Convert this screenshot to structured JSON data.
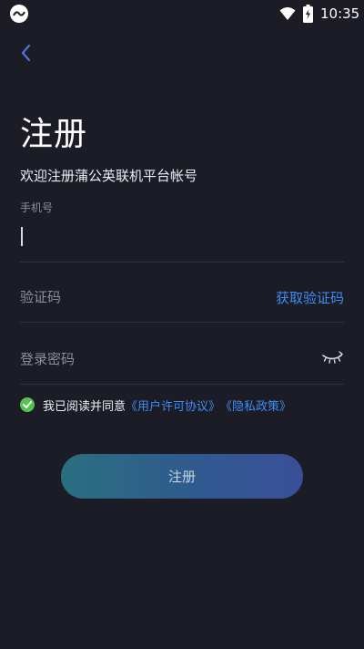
{
  "status_bar": {
    "time": "10:35",
    "app_icon": "app-badge-icon",
    "wifi_icon": "wifi-icon",
    "battery_icon": "battery-charging-icon"
  },
  "header": {
    "back_icon": "chevron-left-icon"
  },
  "title": "注册",
  "subtitle": "欢迎注册蒲公英联机平台帐号",
  "phone": {
    "label": "手机号",
    "value": ""
  },
  "code": {
    "placeholder": "验证码",
    "get_code_label": "获取验证码"
  },
  "password": {
    "placeholder": "登录密码",
    "toggle_icon": "eye-closed-icon"
  },
  "agreement": {
    "checked": true,
    "text": "我已阅读并同意",
    "user_license": "《用户许可协议》",
    "privacy_policy": "《隐私政策》"
  },
  "register_button_label": "注册",
  "colors": {
    "background": "#1b1c26",
    "accent": "#3d8df5",
    "check": "#56c252",
    "divider": "#2f313d"
  }
}
